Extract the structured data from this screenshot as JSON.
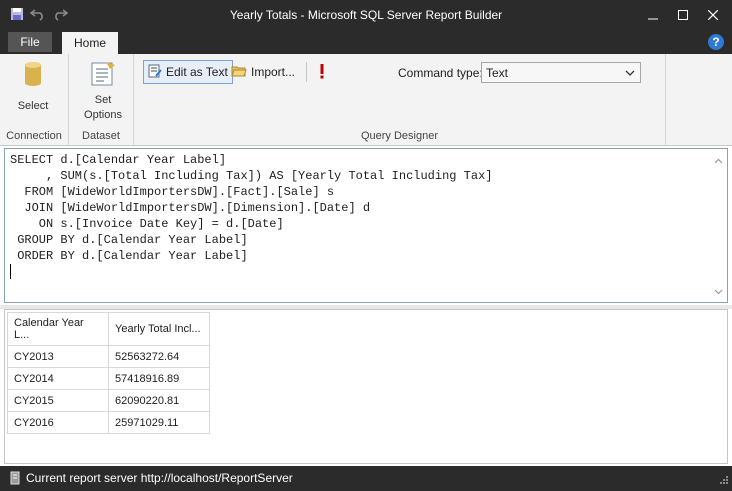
{
  "window": {
    "title": "Yearly Totals - Microsoft SQL Server Report Builder"
  },
  "quick_access": {
    "icons": [
      "save-icon",
      "undo-icon",
      "redo-icon"
    ]
  },
  "tabs": {
    "file": "File",
    "home": "Home",
    "help": "?"
  },
  "ribbon": {
    "connection": {
      "group_label": "Connection",
      "select_label": "Select"
    },
    "dataset": {
      "group_label": "Dataset",
      "set_options_line1": "Set",
      "set_options_line2": "Options"
    },
    "query_designer": {
      "group_label": "Query Designer",
      "edit_as_text": "Edit as Text",
      "import": "Import...",
      "command_type_label": "Command type:",
      "command_type_value": "Text"
    }
  },
  "query": {
    "text": "SELECT d.[Calendar Year Label]\n     , SUM(s.[Total Including Tax]) AS [Yearly Total Including Tax]\n  FROM [WideWorldImportersDW].[Fact].[Sale] s\n  JOIN [WideWorldImportersDW].[Dimension].[Date] d\n    ON s.[Invoice Date Key] = d.[Date]\n GROUP BY d.[Calendar Year Label]\n ORDER BY d.[Calendar Year Label]"
  },
  "results": {
    "columns": [
      "Calendar Year L...",
      "Yearly Total Incl..."
    ],
    "rows": [
      [
        "CY2013",
        "52563272.64"
      ],
      [
        "CY2014",
        "57418916.89"
      ],
      [
        "CY2015",
        "62090220.81"
      ],
      [
        "CY2016",
        "25971029.11"
      ]
    ]
  },
  "status": {
    "text": "Current report server http://localhost/ReportServer"
  },
  "colors": {
    "chrome": "#2b2b2b",
    "ribbon": "#f3f3f3",
    "accent": "#2f7ad1",
    "warning": "#c00000"
  }
}
